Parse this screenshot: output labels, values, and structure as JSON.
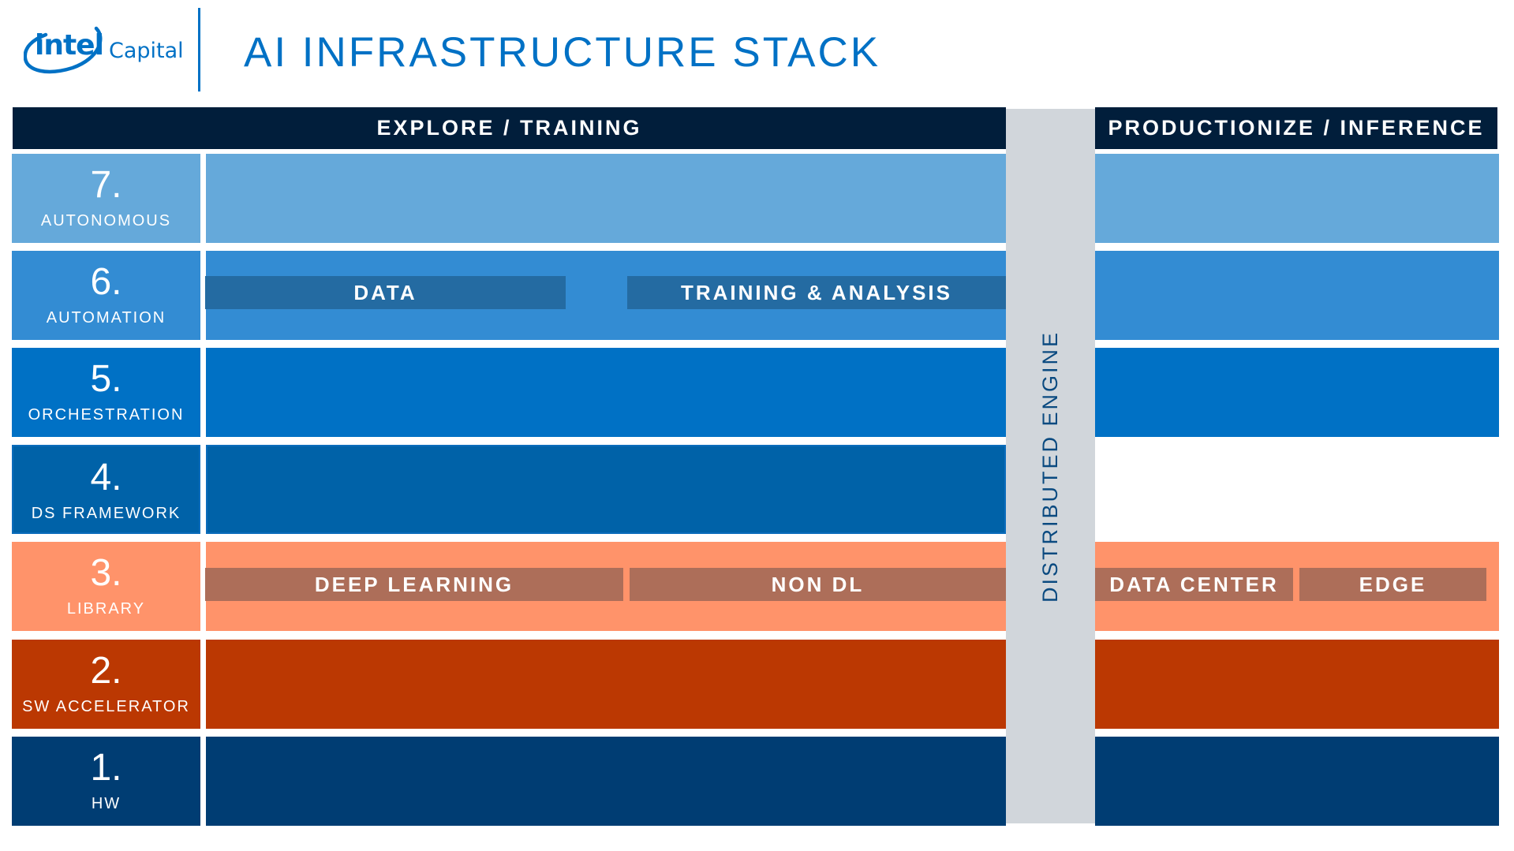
{
  "header": {
    "logo_brand": "intel",
    "logo_suffix": "Capital",
    "title": "AI INFRASTRUCTURE STACK"
  },
  "columns": {
    "explore": "EXPLORE / TRAINING",
    "productionize": "PRODUCTIONIZE / INFERENCE",
    "distributed_engine": "DISTRIBUTED ENGINE"
  },
  "colors": {
    "brand_blue": "#0071C5",
    "header_navy": "#011E3B",
    "engine_gray": "#D1D6DB",
    "row7": "#65A9DA",
    "row6": "#338CD3",
    "row6_sub": "#246BA2",
    "row5": "#0071C5",
    "row4": "#0062A8",
    "row3": "#FF936A",
    "row3_sub": "#AD6E59",
    "row2": "#BB3802",
    "row1": "#003D73"
  },
  "rows": [
    {
      "num": "7.",
      "name": "AUTONOMOUS"
    },
    {
      "num": "6.",
      "name": "AUTOMATION",
      "sub_explore": [
        "DATA",
        "TRAINING & ANALYSIS"
      ]
    },
    {
      "num": "5.",
      "name": "ORCHESTRATION"
    },
    {
      "num": "4.",
      "name": "DS FRAMEWORK"
    },
    {
      "num": "3.",
      "name": "LIBRARY",
      "sub_explore": [
        "DEEP LEARNING",
        "NON DL"
      ],
      "sub_prod": [
        "DATA CENTER",
        "EDGE"
      ]
    },
    {
      "num": "2.",
      "name": "SW ACCELERATOR"
    },
    {
      "num": "1.",
      "name": "HW"
    }
  ]
}
